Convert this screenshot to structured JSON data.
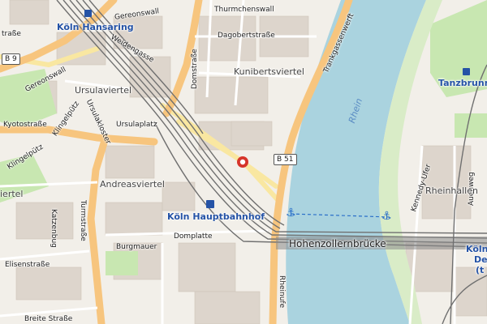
{
  "map": {
    "streets": {
      "thurmchenswall": "Thurmchenswall",
      "gereonswall": "Gereonswall",
      "weidengasse": "Weidengasse",
      "dagobertstrasse": "Dagobertstraße",
      "trankgassenwerft": "Trankgassenwerft",
      "domstrasse": "Domstraße",
      "gereonswall_left": "Gereonswall",
      "ursulaviertel_street": "Ursulaviertel",
      "kyotostrasse": "Kyotostraße",
      "klingelpuetz": "Klingelpütz",
      "ursulakloster": "Ursulakloster",
      "ursulaplatz": "Ursulaplatz",
      "klingelpuetz2": "Klingelpütz",
      "turmstrasse": "Turmstraße",
      "burgmauer": "Burgmauer",
      "domplatte": "Domplatte",
      "katzenbug": "Katzenbug",
      "elisenstrasse": "Elisenstraße",
      "breite_strasse": "Breite Straße",
      "kennedy_ufer": "Kennedy-Ufer",
      "auenweg": "Auenweg",
      "rheinufer": "Rheinufe",
      "strasse_top_left": "traße"
    },
    "districts": {
      "kunibertsviertel": "Kunibertsviertel",
      "ursulaviertel": "Ursulaviertel",
      "andreasviertel": "Andreasviertel",
      "viertel_left": "iertel",
      "rheinhallen": "Rheinhallen"
    },
    "stations": {
      "hansaring": "Köln Hansaring",
      "hauptbahnhof": "Köln Hauptbahnhof",
      "deutz_partial": "Köln",
      "deutz_partial2": "De",
      "deutz_partial3": "(t"
    },
    "poi": {
      "tanzbrunnen": "Tanzbrunn"
    },
    "river": "Rhein",
    "bridge": "Hohenzollernbrücke",
    "shields": {
      "b9": "B 9",
      "b51": "B 51"
    },
    "colors": {
      "land": "#f2efe9",
      "water": "#aad3df",
      "major_road": "#f7c57e",
      "secondary_road": "#f9e7a1",
      "rail": "#7a7a7a",
      "park": "#c8e7b1",
      "building": "#d9d0c9",
      "marker": "#d6342a",
      "station_text": "#2553a6"
    }
  }
}
